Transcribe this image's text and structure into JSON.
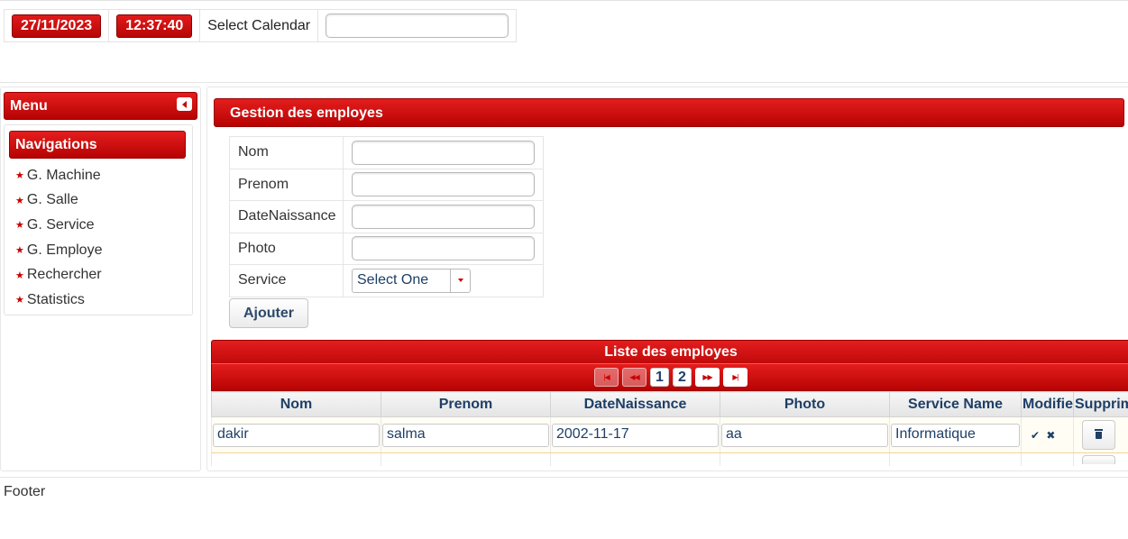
{
  "header": {
    "date": "27/11/2023",
    "time": "12:37:40",
    "calendar_label": "Select Calendar",
    "calendar_value": ""
  },
  "menu": {
    "title": "Menu",
    "section": "Navigations",
    "items": [
      {
        "label": "G. Machine"
      },
      {
        "label": "G. Salle"
      },
      {
        "label": "G. Service"
      },
      {
        "label": "G. Employe"
      },
      {
        "label": "Rechercher"
      },
      {
        "label": "Statistics"
      }
    ]
  },
  "form": {
    "title": "Gestion des employes",
    "fields": {
      "nom": {
        "label": "Nom",
        "value": ""
      },
      "prenom": {
        "label": "Prenom",
        "value": ""
      },
      "date": {
        "label": "DateNaissance",
        "value": ""
      },
      "photo": {
        "label": "Photo",
        "value": ""
      },
      "service": {
        "label": "Service",
        "selected": "Select One"
      }
    },
    "submit_label": "Ajouter"
  },
  "list": {
    "title": "Liste des employes",
    "pages": [
      "1",
      "2"
    ],
    "current_page": "1",
    "columns": [
      "Nom",
      "Prenom",
      "DateNaissance",
      "Photo",
      "Service Name",
      "Modifier",
      "Supprimer"
    ],
    "rows": [
      {
        "nom": "dakir",
        "prenom": "salma",
        "date": "2002-11-17",
        "photo": "aa",
        "service": "Informatique"
      }
    ]
  },
  "icons": {
    "star": "star-icon",
    "edit": "check-icon",
    "cancel": "cross-icon",
    "delete": "trash-icon"
  },
  "colors": {
    "accent": "#cc0000",
    "text_link": "#1e3f66"
  },
  "footer": {
    "text": "Footer"
  }
}
